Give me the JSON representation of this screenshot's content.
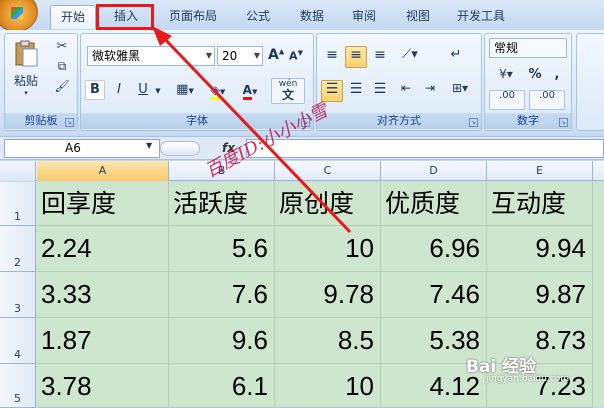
{
  "tabs": [
    {
      "label": "开始",
      "active": true
    },
    {
      "label": "插入",
      "active": false
    },
    {
      "label": "页面布局",
      "active": false
    },
    {
      "label": "公式",
      "active": false
    },
    {
      "label": "数据",
      "active": false
    },
    {
      "label": "审阅",
      "active": false
    },
    {
      "label": "视图",
      "active": false
    },
    {
      "label": "开发工具",
      "active": false
    }
  ],
  "ribbon": {
    "clipboard": {
      "label": "剪贴板",
      "paste_label": "粘贴"
    },
    "font": {
      "label": "字体",
      "font_name": "微软雅黑",
      "font_size": "20",
      "bold": "B",
      "italic": "I",
      "underline": "U",
      "font_color_glyph": "A",
      "grow": "A",
      "shrink": "A",
      "phonetic": "wén"
    },
    "alignment": {
      "label": "对齐方式"
    },
    "number": {
      "label": "数字",
      "format": "常规",
      "percent": "%",
      "comma": ",",
      "inc_decimal": ".00",
      "dec_decimal": ".00"
    }
  },
  "formula_bar": {
    "name_box": "A6",
    "fx": "fx"
  },
  "columns": [
    "A",
    "B",
    "C",
    "D",
    "E"
  ],
  "rows": [
    "1",
    "2",
    "3",
    "4",
    "5"
  ],
  "table": {
    "headers": [
      "回享度",
      "活跃度",
      "原创度",
      "优质度",
      "互动度"
    ],
    "data": [
      [
        "2.24",
        "5.6",
        "10",
        "6.96",
        "9.94"
      ],
      [
        "3.33",
        "7.6",
        "9.78",
        "7.46",
        "9.87"
      ],
      [
        "1.87",
        "9.6",
        "8.5",
        "5.38",
        "8.73"
      ],
      [
        "3.78",
        "6.1",
        "10",
        "4.12",
        "7.23"
      ]
    ]
  },
  "watermark": "百度ID:小小小雪",
  "brand": {
    "logo": "Bai 经验",
    "url": "jingyan.baidu.com"
  },
  "colors": {
    "highlight": "#e8191a",
    "grid_fill": "#cde6cd",
    "ribbon_text": "#15428b"
  }
}
